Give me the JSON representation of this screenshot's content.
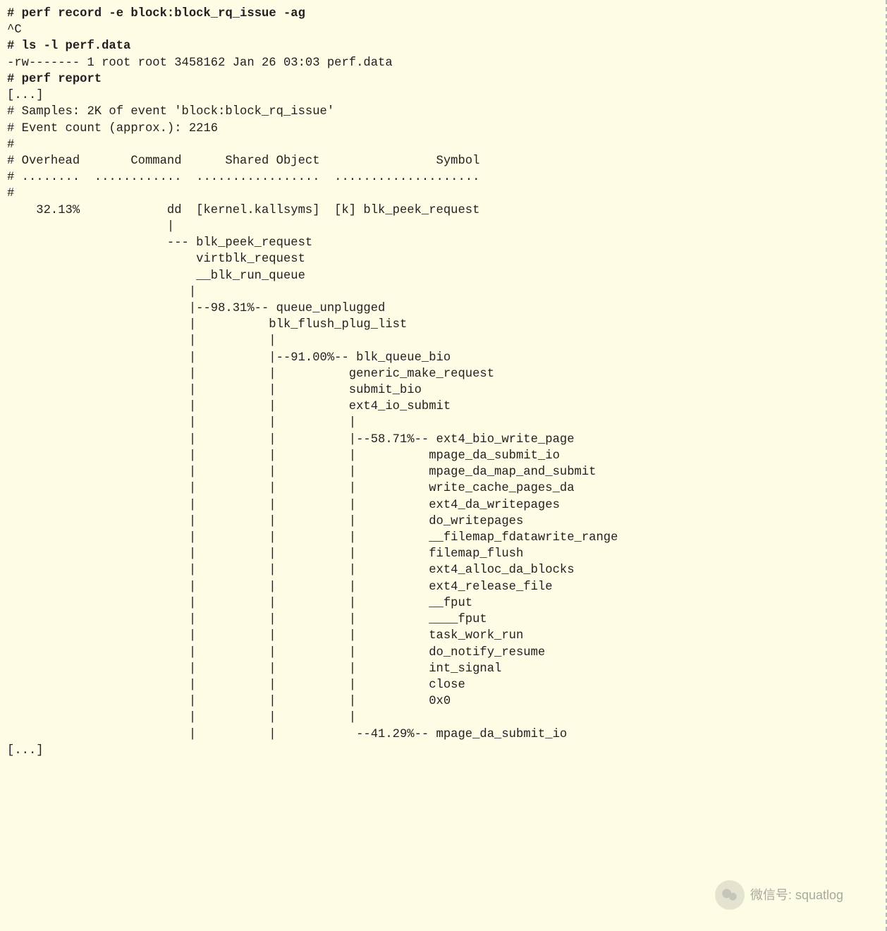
{
  "prompt": "# ",
  "cmd1": "perf record -e block:block_rq_issue -ag",
  "ctrlc": "^C",
  "cmd2": "ls -l perf.data",
  "ls_output": "-rw------- 1 root root 3458162 Jan 26 03:03 perf.data",
  "cmd3": "perf report",
  "ellipsis": "[...]",
  "samples_line": "# Samples: 2K of event 'block:block_rq_issue'",
  "event_count_line": "# Event count (approx.): 2216",
  "hash": "#",
  "hdr_overhead": "# Overhead       Command      Shared Object                Symbol",
  "hdr_dots": "# ........  ............  .................  ....................",
  "row_main": "    32.13%            dd  [kernel.kallsyms]  [k] blk_peek_request",
  "tree": {
    "l01": "                      |",
    "l02": "                      --- blk_peek_request",
    "l03": "                          virtblk_request",
    "l04": "                          __blk_run_queue",
    "l05": "                         |          ",
    "l06": "                         |--98.31%-- queue_unplugged",
    "l07": "                         |          blk_flush_plug_list",
    "l08": "                         |          |          ",
    "l09": "                         |          |--91.00%-- blk_queue_bio",
    "l10": "                         |          |          generic_make_request",
    "l11": "                         |          |          submit_bio",
    "l12": "                         |          |          ext4_io_submit",
    "l13": "                         |          |          |          ",
    "l14": "                         |          |          |--58.71%-- ext4_bio_write_page",
    "l15": "                         |          |          |          mpage_da_submit_io",
    "l16": "                         |          |          |          mpage_da_map_and_submit",
    "l17": "                         |          |          |          write_cache_pages_da",
    "l18": "                         |          |          |          ext4_da_writepages",
    "l19": "                         |          |          |          do_writepages",
    "l20": "                         |          |          |          __filemap_fdatawrite_range",
    "l21": "                         |          |          |          filemap_flush",
    "l22": "                         |          |          |          ext4_alloc_da_blocks",
    "l23": "                         |          |          |          ext4_release_file",
    "l24": "                         |          |          |          __fput",
    "l25": "                         |          |          |          ____fput",
    "l26": "                         |          |          |          task_work_run",
    "l27": "                         |          |          |          do_notify_resume",
    "l28": "                         |          |          |          int_signal",
    "l29": "                         |          |          |          close",
    "l30": "                         |          |          |          0x0",
    "l31": "                         |          |          |          ",
    "l32": "                         |          |           --41.29%-- mpage_da_submit_io"
  },
  "watermark_text": "微信号: squatlog"
}
